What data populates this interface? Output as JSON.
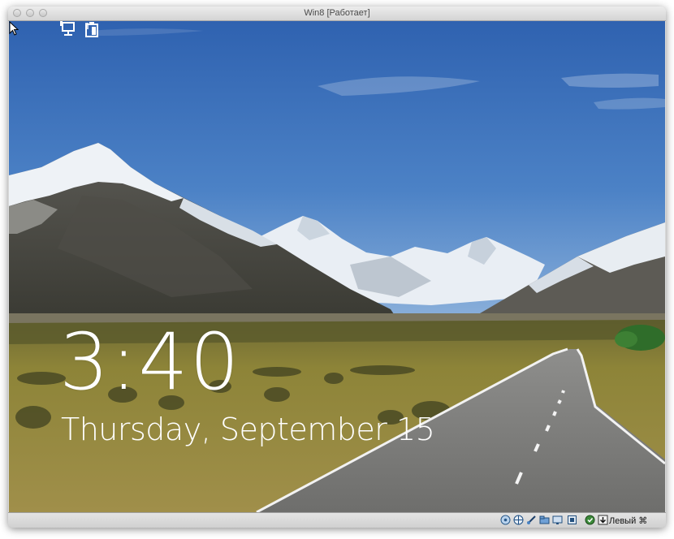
{
  "window": {
    "title": "Win8 [Работает]"
  },
  "lockscreen": {
    "time": "3:40",
    "date": "Thursday, September 15",
    "icons": [
      "network-icon",
      "battery-icon"
    ]
  },
  "statusbar": {
    "icons": [
      "hard-disk-icon",
      "optical-drive-icon",
      "usb-icon",
      "shared-folders-icon",
      "display-icon",
      "network-adapter-icon",
      "capture-icon",
      "download-icon"
    ],
    "host_key": "Левый ⌘"
  }
}
